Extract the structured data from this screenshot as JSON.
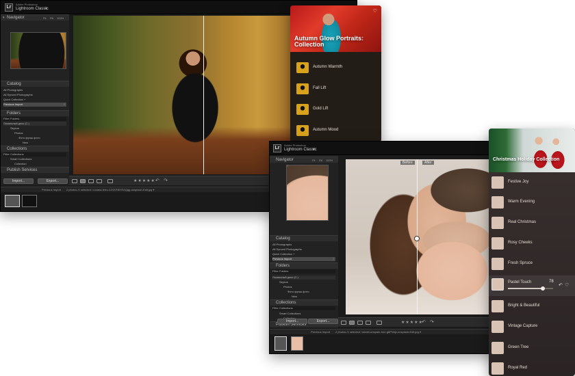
{
  "window1": {
    "brand_top": "Adobe Photoshop",
    "brand": "Lightroom Classic",
    "navigator": {
      "label": "Navigator",
      "zoom": [
        "Fit",
        "Fill",
        "100%",
        "200%"
      ]
    },
    "catalog": {
      "label": "Catalog",
      "items": [
        {
          "label": "All Photographs",
          "count": ""
        },
        {
          "label": "All Synced Photographs",
          "count": ""
        },
        {
          "label": "Quick Collection +",
          "count": ""
        },
        {
          "label": "Previous Import",
          "count": "2"
        }
      ]
    },
    "folders": {
      "label": "Folders",
      "filter": "Filter Folders",
      "volume": "Локальный диск (C:)",
      "tree": [
        "Skylum",
        "Photos",
        "Фото фрэш фото",
        "New"
      ]
    },
    "collections": {
      "label": "Collections",
      "filter": "Filter Collections",
      "tree": [
        "Smart Collections",
        "Collection"
      ]
    },
    "publish": {
      "label": "Publish Services"
    },
    "import": "Import...",
    "export": "Export...",
    "stars": "★★★★★",
    "filmbar": {
      "source": "Previous Import",
      "info": "2 photos /1 selected / roxana-ierru-1JXIVH6YEAQgg-unsplash-Edit.jpg ▾"
    }
  },
  "window2": {
    "brand_top": "Adobe Photoshop",
    "brand": "Lightroom Classic",
    "before": "Before",
    "after": "After",
    "navigator": {
      "label": "Navigator",
      "zoom": [
        "Fit",
        "Fill",
        "100%",
        "200%"
      ]
    },
    "catalog": {
      "label": "Catalog",
      "items": [
        {
          "label": "All Photographs",
          "count": ""
        },
        {
          "label": "All Synced Photographs",
          "count": ""
        },
        {
          "label": "Quick Collection +",
          "count": ""
        },
        {
          "label": "Previous Import",
          "count": "2"
        }
      ]
    },
    "folders": {
      "label": "Folders",
      "filter": "Filter Folders",
      "volume": "Локальный диск (C:)",
      "tree": [
        "Skylum",
        "Photos",
        "Фото фрэш фото",
        "New"
      ]
    },
    "collections": {
      "label": "Collections",
      "filter": "Filter Collections",
      "tree": [
        "Smart Collections",
        "Collection"
      ]
    },
    "publish": {
      "label": "Publish Services"
    },
    "import": "Import...",
    "export": "Export...",
    "stars": "★★★★★",
    "filmbar": {
      "source": "Previous Import",
      "info": "2 photos /1 selected / daniel-unspark-hn2-g8PNhjc-unsplash-Edit.jpg ▾"
    }
  },
  "autumn_panel": {
    "title": "Autumn Glow Portraits: Collection",
    "presets": [
      "Autumn Warmth",
      "Fall Lift",
      "Gold Lift",
      "Autumn Mood"
    ],
    "accent": "#d9a21d"
  },
  "holiday_panel": {
    "title": "Christmas Holiday Collection",
    "presets": [
      "Festive Joy",
      "Warm Evening",
      "Real Christmas",
      "Rosy Cheeks",
      "Fresh Spruce",
      "Pastel Touch",
      "Bright & Beautiful",
      "Vintage Capture",
      "Green Tree",
      "Royal Red"
    ],
    "active_index": 5,
    "active_value": "78",
    "active_level": 0.78
  }
}
